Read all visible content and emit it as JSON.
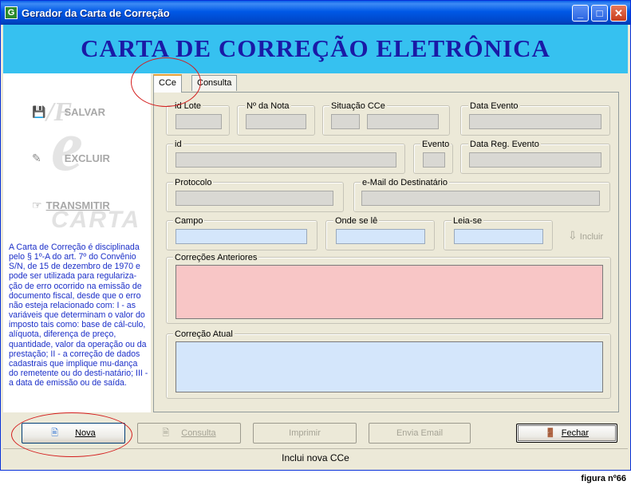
{
  "window": {
    "title": "Gerador da Carta de Correção",
    "app_icon_glyph": "G",
    "controls": {
      "minimize": "_",
      "maximize": "□",
      "close": "✕"
    }
  },
  "banner": {
    "title": "CARTA DE CORREÇÃO ELETRÔNICA"
  },
  "side": {
    "save_label": "SALVAR",
    "delete_label": "EXCLUIR",
    "transmit_label": "TRANSMITIR",
    "logo_text": "CARTA",
    "description": "A Carta de Correção é disciplinada pelo § 1º-A do art. 7º do Convênio S/N, de 15 de dezembro de 1970 e pode ser utilizada para regulariza-ção de erro ocorrido na emissão de documento fiscal, desde que o erro não esteja relacionado com: I - as variáveis que determinam o valor do imposto tais como: base de cál-culo, alíquota, diferença de preço, quantidade, valor da operação ou da prestação; II - a correção de dados cadastrais que implique mu-dança do remetente ou do desti-natário; III - a data de emissão ou de saída."
  },
  "tabs": [
    {
      "label": "CCe",
      "active": true
    },
    {
      "label": "Consulta",
      "active": false
    }
  ],
  "form": {
    "id_lote": {
      "label": "id Lote",
      "value": ""
    },
    "numero_nota": {
      "label": "Nº da Nota",
      "value": ""
    },
    "situacao_cce": {
      "label": "Situação CCe",
      "value": ""
    },
    "data_evento": {
      "label": "Data Evento",
      "value": ""
    },
    "id": {
      "label": "id",
      "value": ""
    },
    "evento": {
      "label": "Evento",
      "value": ""
    },
    "data_reg_evento": {
      "label": "Data Reg. Evento",
      "value": ""
    },
    "protocolo": {
      "label": "Protocolo",
      "value": ""
    },
    "email_destinatario": {
      "label": "e-Mail do Destinatário",
      "value": ""
    },
    "campo": {
      "label": "Campo",
      "value": ""
    },
    "onde_se_le": {
      "label": "Onde se lê",
      "value": ""
    },
    "leia_se": {
      "label": "Leia-se",
      "value": ""
    },
    "incluir_label": "Incluir",
    "correcoes_anteriores": {
      "label": "Correções Anteriores",
      "value": ""
    },
    "correcao_atual": {
      "label": "Correção Atual",
      "value": ""
    }
  },
  "buttons": {
    "nova": "Nova",
    "consulta": "Consulta",
    "imprimir": "Imprimir",
    "envia_email": "Envia Email",
    "fechar": "Fechar"
  },
  "status_text": "Inclui nova CCe",
  "caption": "figura nº66",
  "colors": {
    "banner": "#36c1f0",
    "banner_text": "#1a1aa6",
    "description_text": "#1a2ec8",
    "annotation": "#d41c1c"
  }
}
